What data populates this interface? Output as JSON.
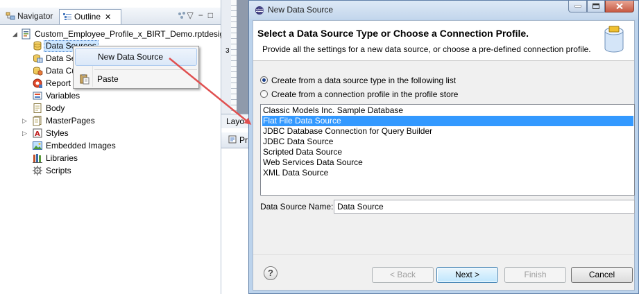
{
  "outline": {
    "tabs": {
      "navigator": "Navigator",
      "outline": "Outline"
    },
    "root": "Custom_Employee_Profile_x_BIRT_Demo.rptdesign",
    "items": [
      {
        "label": "Data Sources"
      },
      {
        "label": "Data Se"
      },
      {
        "label": "Data Cu"
      },
      {
        "label": "Report"
      },
      {
        "label": "Variables"
      },
      {
        "label": "Body"
      },
      {
        "label": "MasterPages"
      },
      {
        "label": "Styles"
      },
      {
        "label": "Embedded Images"
      },
      {
        "label": "Libraries"
      },
      {
        "label": "Scripts"
      }
    ]
  },
  "context_menu": {
    "items": [
      {
        "label": "New Data Source"
      },
      {
        "label": "Paste"
      }
    ]
  },
  "editor": {
    "ruler_mark": "3",
    "tab_layout": "Layo",
    "tab_properties": "Pr"
  },
  "dialog": {
    "title": "New Data Source",
    "header_title": "Select a Data Source Type or Choose a Connection Profile.",
    "header_desc": "Provide all the settings for a new data source, or choose a pre-defined connection profile.",
    "radio_type": "Create from a data source type in the following list",
    "radio_profile": "Create from a connection profile in the profile store",
    "sources": [
      "Classic Models Inc. Sample Database",
      "Flat File Data Source",
      "JDBC Database Connection for Query Builder",
      "JDBC Data Source",
      "Scripted Data Source",
      "Web Services Data Source",
      "XML Data Source"
    ],
    "name_label": "Data Source Name:",
    "name_value": "Data Source",
    "buttons": {
      "help": "?",
      "back": "< Back",
      "next": "Next >",
      "finish": "Finish",
      "cancel": "Cancel"
    }
  },
  "colors": {
    "selection": "#3399ff",
    "arrow": "#e05050"
  }
}
